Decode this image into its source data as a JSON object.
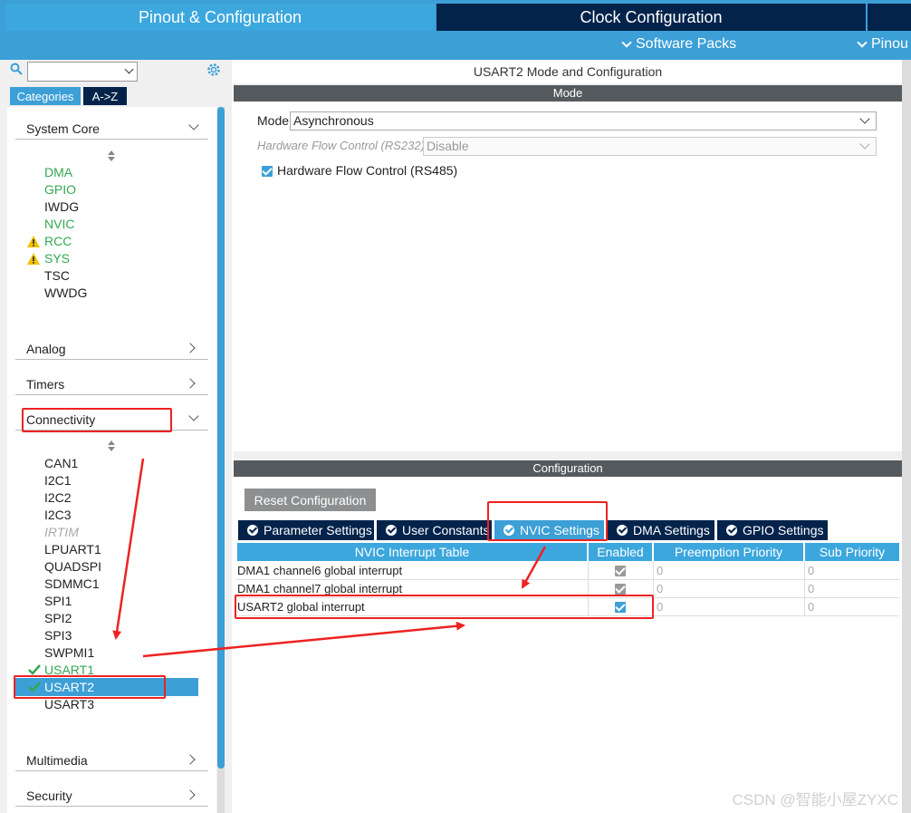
{
  "header": {
    "tab_pinout": "Pinout & Configuration",
    "tab_clock": "Clock Configuration",
    "subtab_software": "Software Packs",
    "subtab_pinout": "Pinou"
  },
  "sidebar": {
    "tab_categories": "Categories",
    "tab_az": "A->Z",
    "system_core": {
      "label": "System Core",
      "items": [
        "DMA",
        "GPIO",
        "IWDG",
        "NVIC",
        "RCC",
        "SYS",
        "TSC",
        "WWDG"
      ]
    },
    "analog": "Analog",
    "timers": "Timers",
    "connectivity": {
      "label": "Connectivity",
      "items": [
        "CAN1",
        "I2C1",
        "I2C2",
        "I2C3",
        "IRTIM",
        "LPUART1",
        "QUADSPI",
        "SDMMC1",
        "SPI1",
        "SPI2",
        "SPI3",
        "SWPMI1",
        "USART1",
        "USART2",
        "USART3"
      ]
    },
    "multimedia": "Multimedia",
    "security": "Security"
  },
  "main": {
    "title": "USART2 Mode and Configuration",
    "mode_header": "Mode",
    "mode_label": "Mode",
    "mode_value": "Asynchronous",
    "hw_rs232_label": "Hardware Flow Control (RS232)",
    "hw_rs232_value": "Disable",
    "hw_rs485_label": "Hardware Flow Control (RS485)",
    "config_header": "Configuration",
    "reset_button": "Reset Configuration",
    "tabs": [
      "Parameter Settings",
      "User Constants",
      "NVIC Settings",
      "DMA Settings",
      "GPIO Settings"
    ],
    "active_tab": "NVIC Settings",
    "table": {
      "headers": [
        "NVIC Interrupt Table",
        "Enabled",
        "Preemption Priority",
        "Sub Priority"
      ],
      "rows": [
        {
          "name": "DMA1 channel6 global interrupt",
          "preempt": "0",
          "sub": "0"
        },
        {
          "name": "DMA1 channel7 global interrupt",
          "preempt": "0",
          "sub": "0"
        },
        {
          "name": "USART2 global interrupt",
          "preempt": "0",
          "sub": "0"
        }
      ]
    }
  },
  "watermark": "CSDN @智能小屋ZYXC",
  "colors": {
    "accent": "#3c9fd6",
    "navy": "#03234b",
    "green": "#32a852",
    "annotation_red": "#e22222"
  }
}
